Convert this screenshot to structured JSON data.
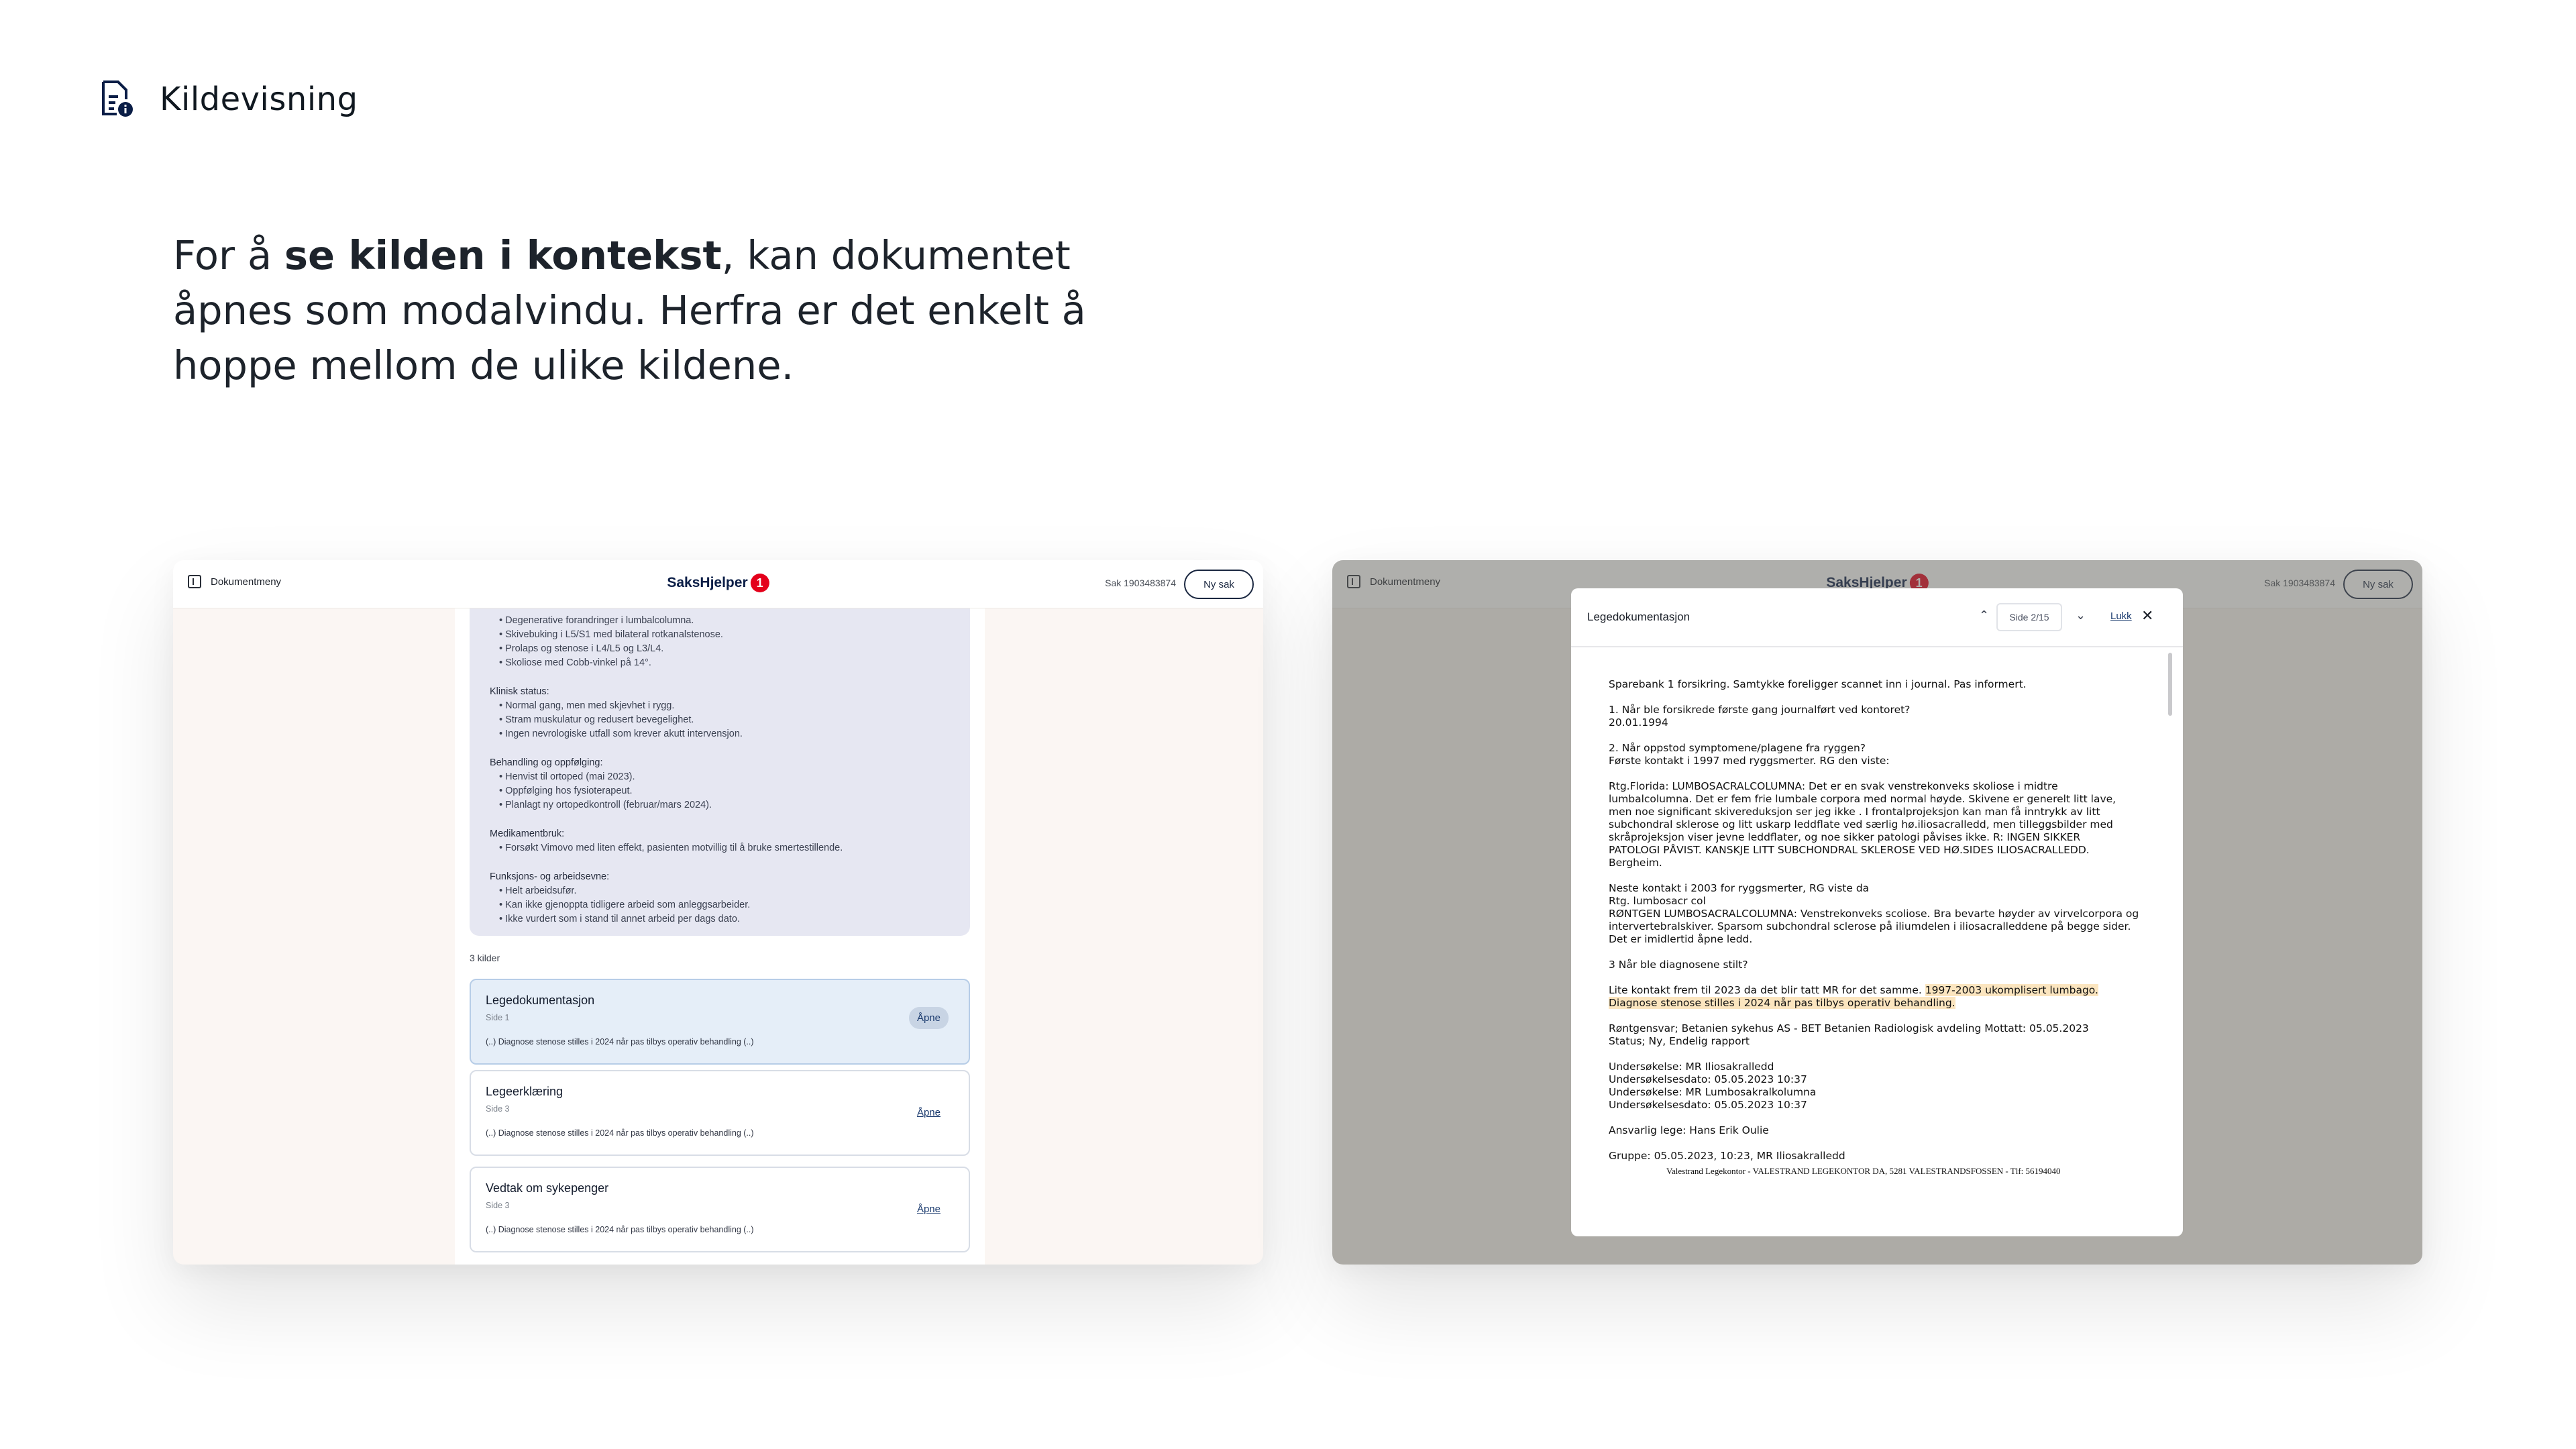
{
  "header": {
    "icon": "document-info-icon",
    "title": "Kildevisning"
  },
  "intro": {
    "before": "For å ",
    "bold": "se kilden i kontekst",
    "after": ", kan dokumentet åpnes som modalvindu. Herfra er det enkelt å hoppe mellom de ulike kildene."
  },
  "app": {
    "menu_label": "Dokumentmeny",
    "logo_text": "SaksHjelper",
    "logo_badge": "1",
    "case_id": "Sak 1903483874",
    "new_case": "Ny sak"
  },
  "summary": {
    "first_items": [
      "Degenerative forandringer i lumbalcolumna.",
      "Skivebuking i L5/S1 med bilateral rotkanalstenose.",
      "Prolaps og stenose i L4/L5 og L3/L4.",
      "Skoliose med Cobb-vinkel på 14°."
    ],
    "sections": [
      {
        "heading": "Klinisk status:",
        "items": [
          "Normal gang, men med skjevhet i rygg.",
          "Stram muskulatur og redusert bevegelighet.",
          "Ingen nevrologiske utfall som krever akutt intervensjon."
        ]
      },
      {
        "heading": "Behandling og oppfølging:",
        "items": [
          "Henvist til ortoped (mai 2023).",
          "Oppfølging hos fysioterapeut.",
          "Planlagt ny ortopedkontroll (februar/mars 2024)."
        ]
      },
      {
        "heading": "Medikamentbruk:",
        "items": [
          "Forsøkt Vimovo med liten effekt, pasienten motvillig til å bruke smertestillende."
        ]
      },
      {
        "heading": "Funksjons- og arbeidsevne:",
        "items": [
          "Helt arbeidsufør.",
          "Kan ikke gjenoppta tidligere arbeid som anleggsarbeider.",
          "Ikke vurdert som i stand til annet arbeid per dags dato."
        ]
      }
    ]
  },
  "sources": {
    "label": "3 kilder",
    "open_label": "Åpne",
    "items": [
      {
        "title": "Legedokumentasjon",
        "page": "Side 1",
        "excerpt": "(..) Diagnose stenose stilles i 2024 når pas tilbys operativ behandling (..)"
      },
      {
        "title": "Legeerklæring",
        "page": "Side 3",
        "excerpt": "(..) Diagnose stenose stilles i 2024 når pas tilbys operativ behandling (..)"
      },
      {
        "title": "Vedtak om sykepenger",
        "page": "Side 3",
        "excerpt": "(..) Diagnose stenose stilles i 2024 når pas tilbys operativ behandling (..)"
      }
    ]
  },
  "modal": {
    "title": "Legedokumentasjon",
    "page_indicator": "Side 2/15",
    "close_label": "Lukk",
    "paragraphs": [
      "Sparebank 1 forsikring. Samtykke foreligger scannet inn i journal. Pas informert.",
      "1. Når ble forsikrede første gang journalført ved kontoret?\n20.01.1994",
      "2. Når oppstod symptomene/plagene fra ryggen?\nFørste kontakt i 1997 med ryggsmerter. RG den viste:",
      " Rtg.Florida: LUMBOSACRALCOLUMNA: Det er en svak venstrekonveks skoliose i midtre\nlumbalcolumna. Det er fem frie lumbale corpora med normal høyde. Skivene er generelt litt lave,\nmen noe significant skivereduksjon ser jeg ikke . I frontalprojeksjon kan man få inntrykk av litt\nsubchondral sklerose og litt uskarp leddflate ved særlig hø.iliosacralledd, men tilleggsbilder med\nskråprojeksjon viser jevne leddflater, og noe sikker patologi påvises ikke. R: INGEN SIKKER\nPATOLOGI PÅVIST. KANSKJE LITT SUBCHONDRAL SKLEROSE VED HØ.SIDES ILIOSACRALLEDD.\nBergheim.",
      "Neste kontakt i 2003 for ryggsmerter, RG viste da\n Rtg. lumbosacr col\nRØNTGEN LUMBOSACRALCOLUMNA: Venstrekonveks scoliose. Bra bevarte høyder av virvelcorpora og\nintervertebralskiver. Sparsom subchondral sclerose på iliumdelen i iliosacralleddene på begge sider.\nDet er imidlertid åpne ledd.",
      "3 Når ble diagnosene stilt?"
    ],
    "highlight_lead": "Lite kontakt frem til 2023 da det blir tatt MR for det samme. ",
    "highlight_line1": "1997-2003 ukomplisert lumbago.",
    "highlight_line2": "Diagnose stenose stilles i 2024 når pas tilbys operativ behandling.",
    "paragraphs_after": [
      "Røntgensvar; Betanien sykehus AS - BET Betanien Radiologisk avdeling Mottatt: 05.05.2023\nStatus; Ny, Endelig rapport",
      "Undersøkelse: MR Iliosakralledd\nUndersøkelsesdato: 05.05.2023 10:37\nUndersøkelse: MR Lumbosakralkolumna\nUndersøkelsesdato: 05.05.2023 10:37",
      "Ansvarlig lege: Hans Erik Oulie",
      "Gruppe: 05.05.2023, 10:23, MR Iliosakralledd"
    ],
    "footer": "Valestrand Legekontor - VALESTRAND LEGEKONTOR DA, 5281 VALESTRANDSFOSSEN - Tlf: 56194040"
  },
  "colors": {
    "brand_navy": "#0a1d46",
    "brand_red": "#e4001b",
    "highlight": "#fbe5bf",
    "active_card": "#e5eef8"
  }
}
